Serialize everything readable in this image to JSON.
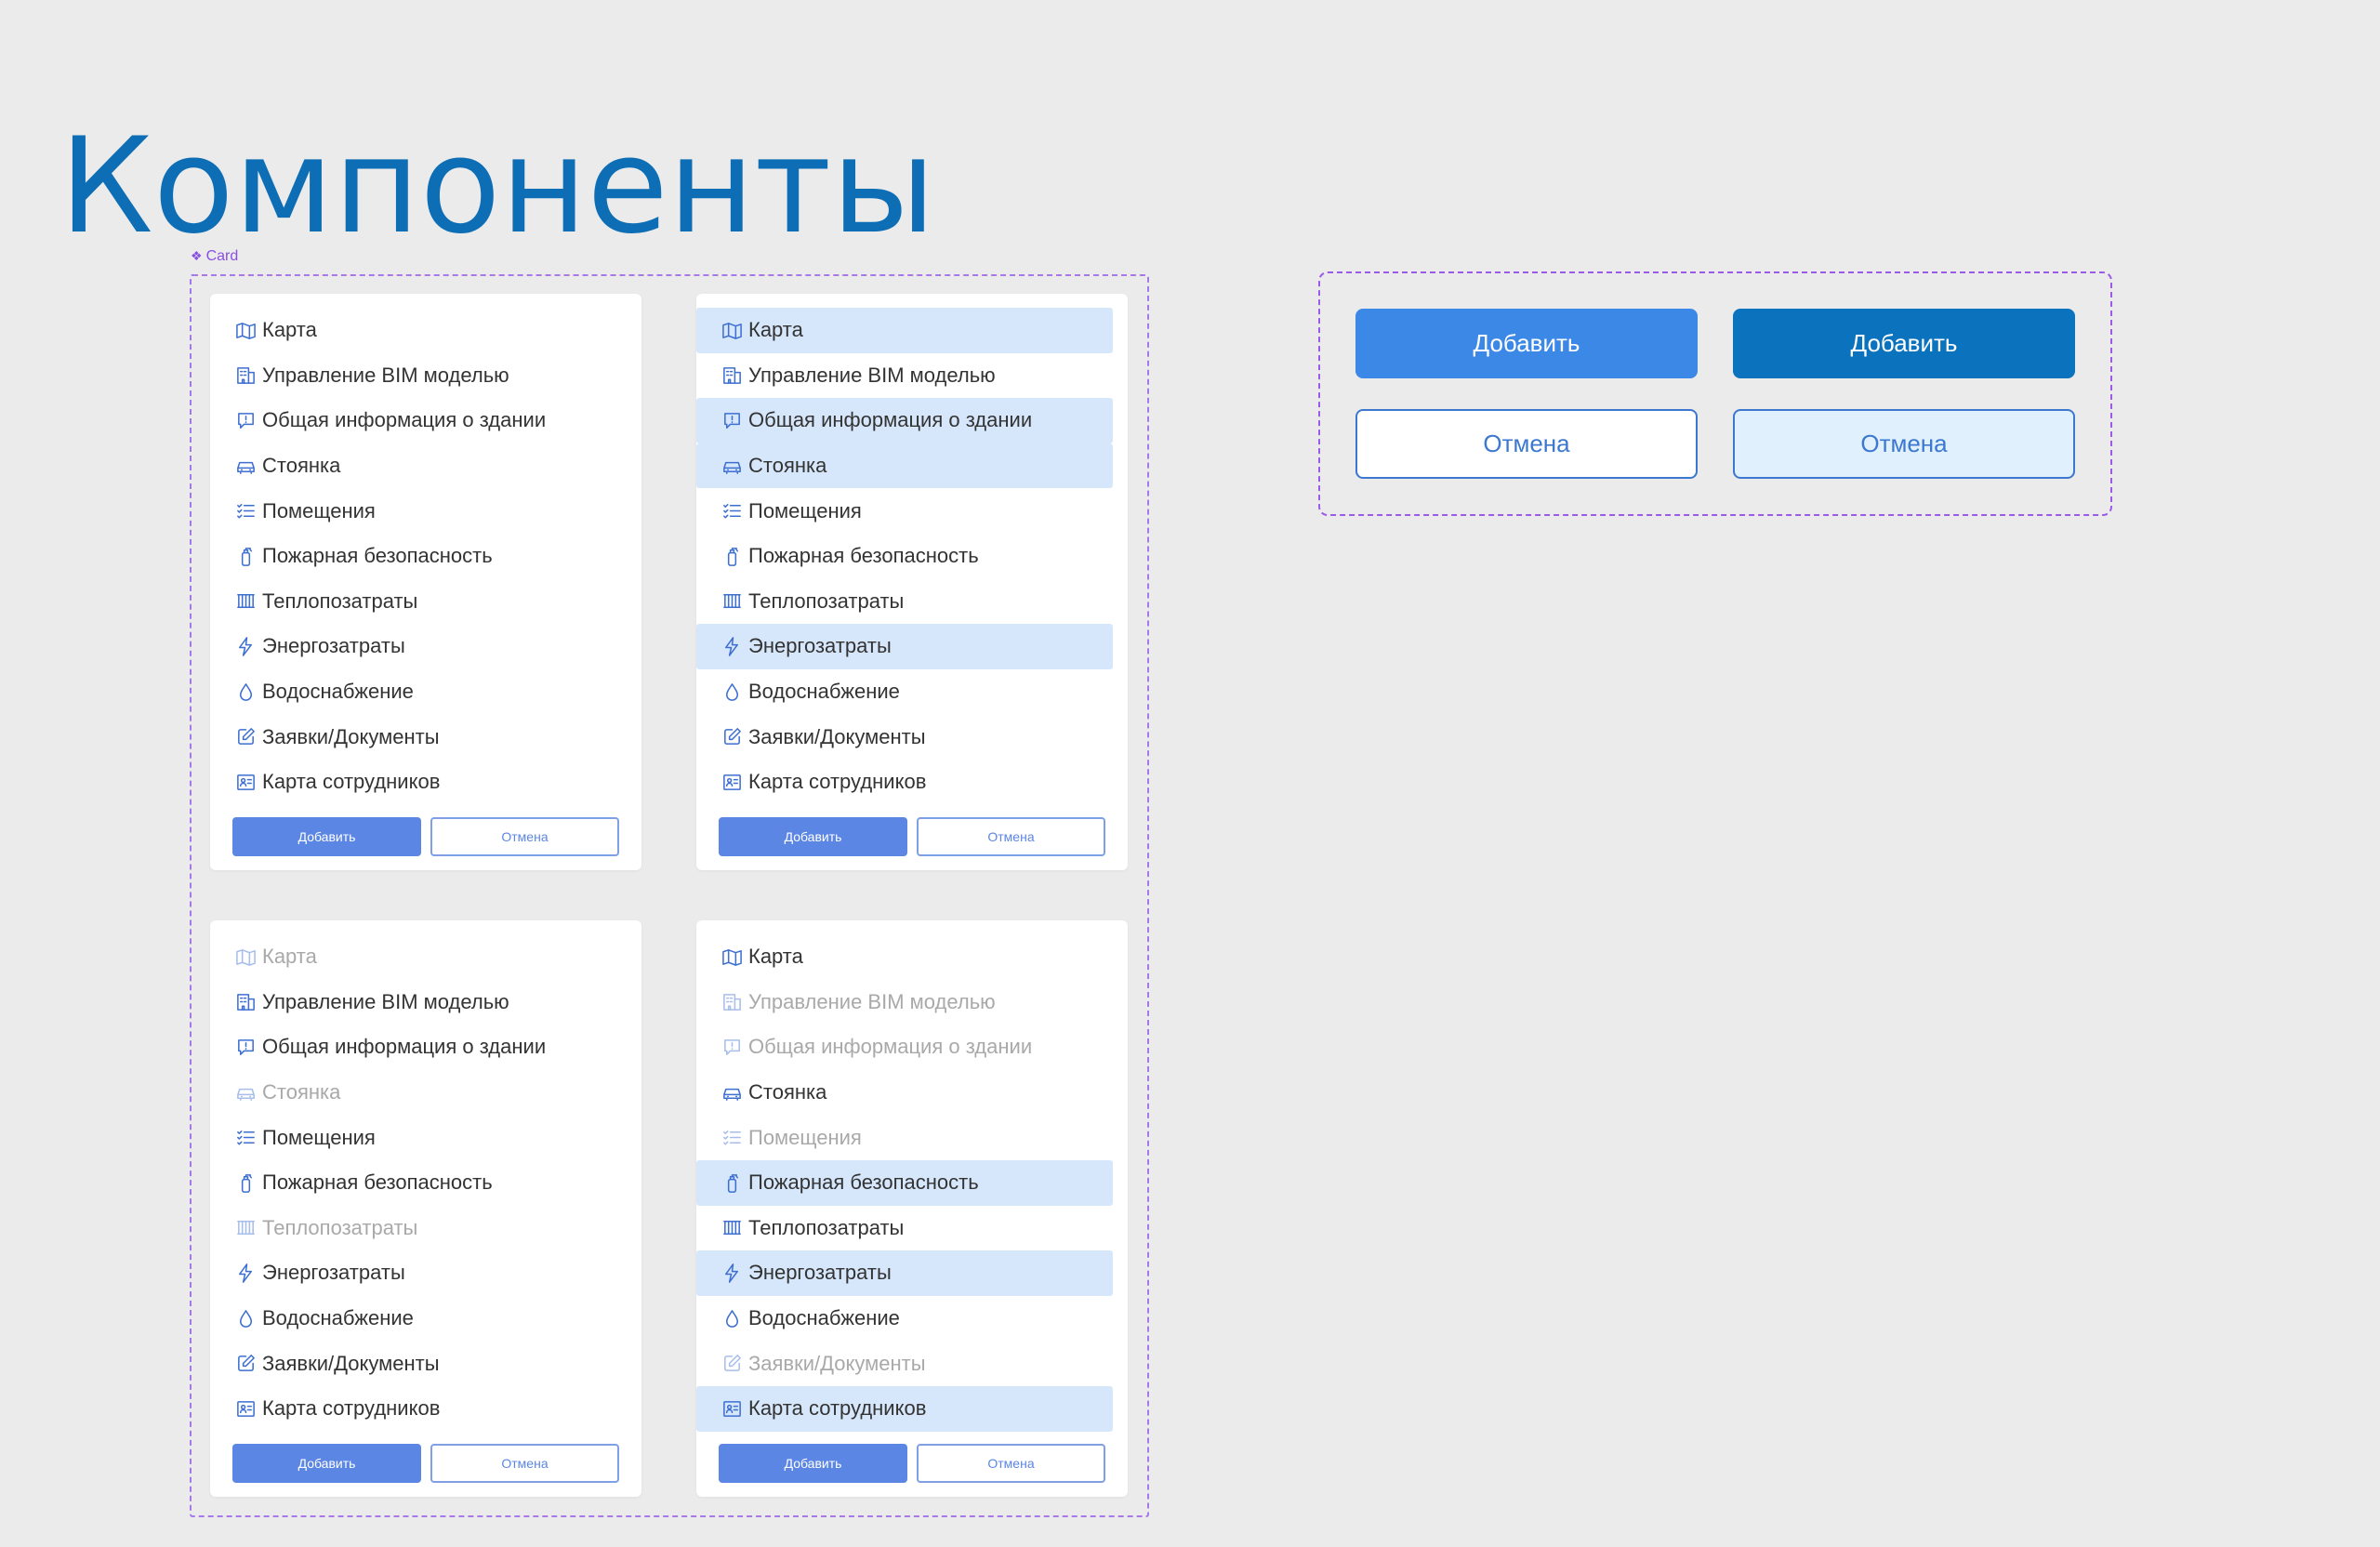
{
  "page": {
    "title": "Компоненты"
  },
  "frame": {
    "label": "Card",
    "glyph": "❖"
  },
  "items": [
    "Карта",
    "Управление BIM моделью",
    "Общая информация о здании",
    "Стоянка",
    "Помещения",
    "Пожарная безопасность",
    "Теплопозатраты",
    "Энергозатраты",
    "Водоснабжение",
    "Заявки/Документы",
    "Карта сотрудников"
  ],
  "icons": [
    "map-icon",
    "building-icon",
    "info-bubble-icon",
    "car-icon",
    "checklist-icon",
    "fire-extinguisher-icon",
    "radiator-icon",
    "lightning-icon",
    "water-drop-icon",
    "edit-icon",
    "badge-icon"
  ],
  "cards": [
    {
      "highlighted": [],
      "disabled": []
    },
    {
      "highlighted": [
        0,
        2,
        3,
        7
      ],
      "disabled": []
    },
    {
      "highlighted": [],
      "disabled": [
        0,
        3,
        6
      ]
    },
    {
      "highlighted": [
        5,
        7,
        10
      ],
      "disabled": [
        1,
        2,
        4,
        9
      ]
    }
  ],
  "card_buttons": {
    "primary": "Добавить",
    "secondary": "Отмена"
  },
  "buttons": {
    "add_default": "Добавить",
    "add_pressed": "Добавить",
    "cancel_default": "Отмена",
    "cancel_hover": "Отмена"
  },
  "colors": {
    "accent": "#0d6eb5",
    "primary": "#3c88e7",
    "primary_dark": "#0b72bd",
    "highlight": "#d7e7fb",
    "frame": "#a678ea",
    "icon": "#3d6fd1"
  }
}
